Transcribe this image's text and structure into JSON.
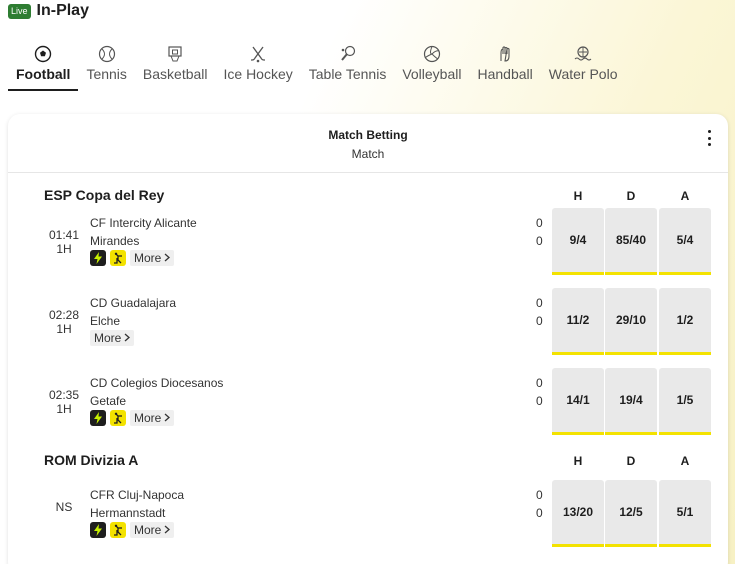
{
  "header": {
    "live_badge": "Live",
    "title": "In-Play"
  },
  "sports": [
    {
      "label": "Football",
      "icon": "football-icon"
    },
    {
      "label": "Tennis",
      "icon": "tennis-icon"
    },
    {
      "label": "Basketball",
      "icon": "basketball-icon"
    },
    {
      "label": "Ice Hockey",
      "icon": "ice-hockey-icon"
    },
    {
      "label": "Table Tennis",
      "icon": "table-tennis-icon"
    },
    {
      "label": "Volleyball",
      "icon": "volleyball-icon"
    },
    {
      "label": "Handball",
      "icon": "handball-icon"
    },
    {
      "label": "Water Polo",
      "icon": "water-polo-icon"
    }
  ],
  "active_sport": "Football",
  "market": {
    "title": "Match Betting",
    "subtitle": "Match"
  },
  "leagues": [
    {
      "name": "ESP Copa del Rey",
      "columns": [
        "H",
        "D",
        "A"
      ],
      "matches": [
        {
          "time": "01:41",
          "period": "1H",
          "home": "CF Intercity Alicante",
          "away": "Mirandes",
          "home_score": "0",
          "away_score": "0",
          "odds": [
            "9/4",
            "85/40",
            "5/4"
          ],
          "more": "More",
          "has_icons": true
        },
        {
          "time": "02:28",
          "period": "1H",
          "home": "CD Guadalajara",
          "away": "Elche",
          "home_score": "0",
          "away_score": "0",
          "odds": [
            "11/2",
            "29/10",
            "1/2"
          ],
          "more": "More",
          "has_icons": false
        },
        {
          "time": "02:35",
          "period": "1H",
          "home": "CD Colegios Diocesanos",
          "away": "Getafe",
          "home_score": "0",
          "away_score": "0",
          "odds": [
            "14/1",
            "19/4",
            "1/5"
          ],
          "more": "More",
          "has_icons": true
        }
      ]
    },
    {
      "name": "ROM Divizia A",
      "columns": [
        "H",
        "D",
        "A"
      ],
      "matches": [
        {
          "time": "NS",
          "period": "",
          "home": "CFR Cluj-Napoca",
          "away": "Hermannstadt",
          "home_score": "0",
          "away_score": "0",
          "odds": [
            "13/20",
            "12/5",
            "5/1"
          ],
          "more": "More",
          "has_icons": true
        }
      ]
    }
  ],
  "colors": {
    "live_green": "#2e7d32",
    "accent_yellow": "#f3e200",
    "odds_bg": "#e9e9e9"
  }
}
